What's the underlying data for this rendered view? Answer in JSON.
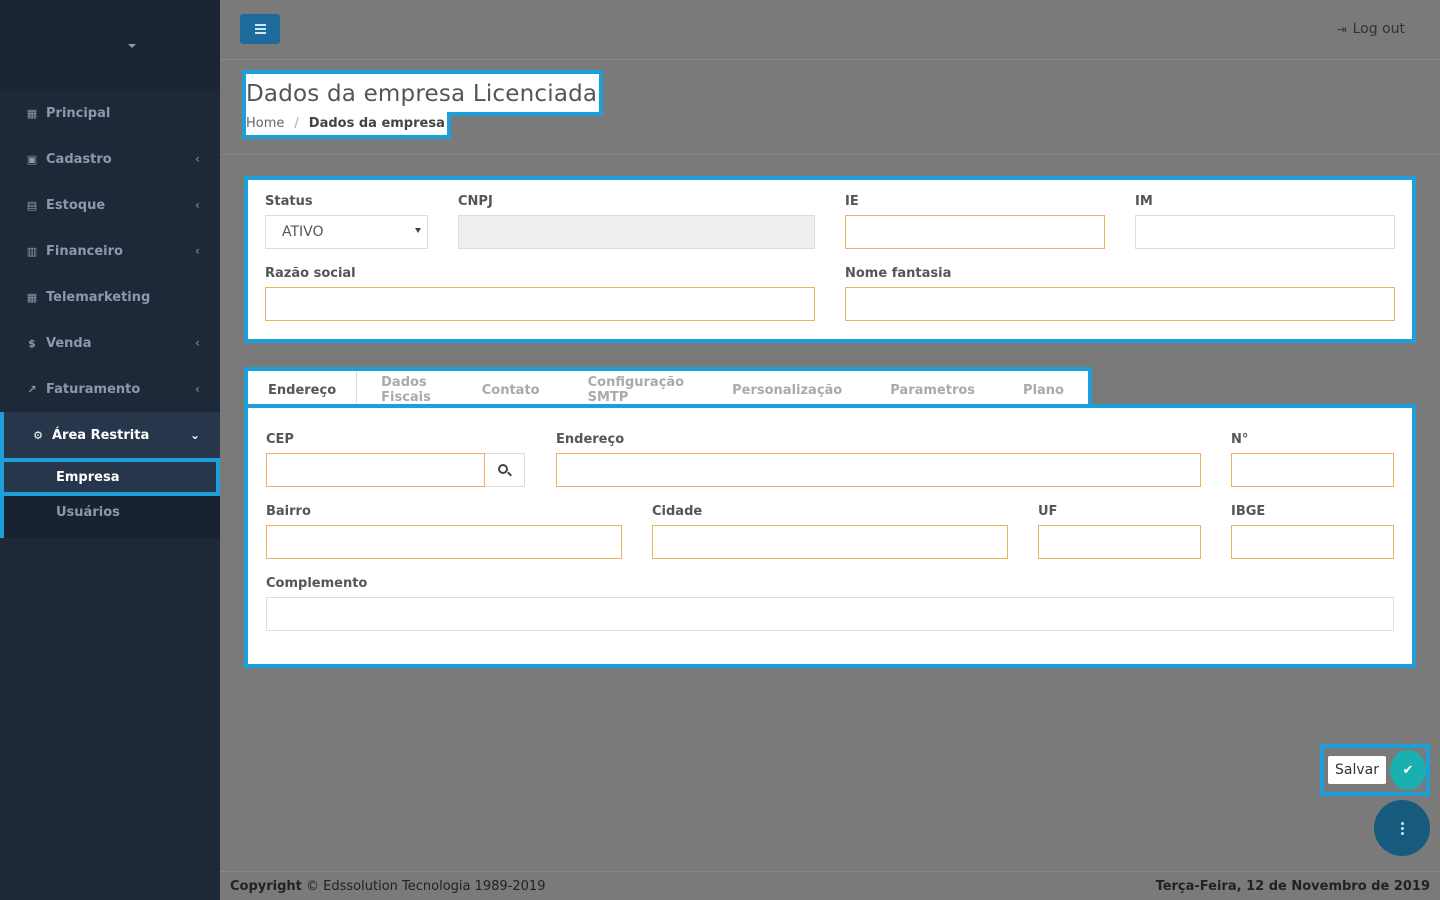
{
  "sidebar": {
    "items": [
      {
        "label": "Principal",
        "icon": "grid-icon",
        "glyph": "▦",
        "has_chevron": false
      },
      {
        "label": "Cadastro",
        "icon": "archive-icon",
        "glyph": "▣",
        "has_chevron": true
      },
      {
        "label": "Estoque",
        "icon": "box-icon",
        "glyph": "▤",
        "has_chevron": true
      },
      {
        "label": "Financeiro",
        "icon": "bank-icon",
        "glyph": "▥",
        "has_chevron": true
      },
      {
        "label": "Telemarketing",
        "icon": "calendar-icon",
        "glyph": "▦",
        "has_chevron": false
      },
      {
        "label": "Venda",
        "icon": "dollar-icon",
        "glyph": "$",
        "has_chevron": true
      },
      {
        "label": "Faturamento",
        "icon": "chart-line-icon",
        "glyph": "↗",
        "has_chevron": true
      }
    ],
    "active_item": {
      "label": "Área Restrita",
      "icon": "cogs-icon",
      "glyph": "⚙"
    },
    "submenu": [
      {
        "label": "Empresa",
        "selected": true
      },
      {
        "label": "Usuários",
        "selected": false
      }
    ]
  },
  "topbar": {
    "logout_label": "Log out"
  },
  "page": {
    "title": "Dados da empresa Licenciada",
    "breadcrumb_home": "Home",
    "breadcrumb_sep": "/",
    "breadcrumb_current": "Dados da empresa"
  },
  "company_form": {
    "status_label": "Status",
    "status_value": "ATIVO",
    "cnpj_label": "CNPJ",
    "cnpj_value": "",
    "ie_label": "IE",
    "ie_value": "",
    "im_label": "IM",
    "im_value": "",
    "razao_label": "Razão social",
    "razao_value": "",
    "fantasia_label": "Nome fantasia",
    "fantasia_value": ""
  },
  "tabs": [
    "Endereço",
    "Dados Fiscais",
    "Contato",
    "Configuração SMTP",
    "Personalização",
    "Parametros",
    "Plano"
  ],
  "address_form": {
    "cep_label": "CEP",
    "endereco_label": "Endereço",
    "numero_label": "N°",
    "bairro_label": "Bairro",
    "cidade_label": "Cidade",
    "uf_label": "UF",
    "ibge_label": "IBGE",
    "complemento_label": "Complemento"
  },
  "actions": {
    "save_label": "Salvar"
  },
  "footer": {
    "copyright_bold": "Copyright",
    "copyright_rest": " © Edssolution Tecnologia 1989-2019",
    "date": "Terça-Feira, 12 de Novembro de 2019"
  },
  "colors": {
    "accent": "#1e9fd8",
    "sidebar_bg": "#1d2939",
    "input_border": "#f0b060",
    "save_fab": "#1ab0b0"
  }
}
